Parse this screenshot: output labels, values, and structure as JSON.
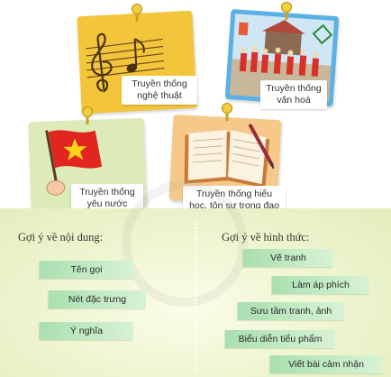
{
  "cards": [
    {
      "label": "Truyền thống nghệ thuật"
    },
    {
      "label": "Truyền thống văn hoá"
    },
    {
      "label": "Truyền thống yêu nước"
    },
    {
      "label": "Truyền thống hiếu học, tôn sư trọng đạo"
    }
  ],
  "content_section": {
    "title": "Gợi ý về nội dung:",
    "items": [
      "Tên gọi",
      "Nét đặc trưng",
      "Ý nghĩa"
    ]
  },
  "form_section": {
    "title": "Gợi ý về hình thức:",
    "items": [
      "Vẽ tranh",
      "Làm áp phích",
      "Sưu tầm tranh, ảnh",
      "Biểu diễn tiểu phẩm",
      "Viết bài cảm nhận"
    ]
  },
  "icons": [
    "music-note-icon",
    "festival-icon",
    "flag-icon",
    "book-pen-icon",
    "pin-icon"
  ],
  "colors": {
    "yellow_card": "#f3c53a",
    "festival_border": "#5cb0e4",
    "green_card": "#dcebb8",
    "orange_card": "#f6c98a",
    "tag_green": "#b5e4ba",
    "flag_red": "#e0261f",
    "star_yellow": "#ffd21c"
  }
}
